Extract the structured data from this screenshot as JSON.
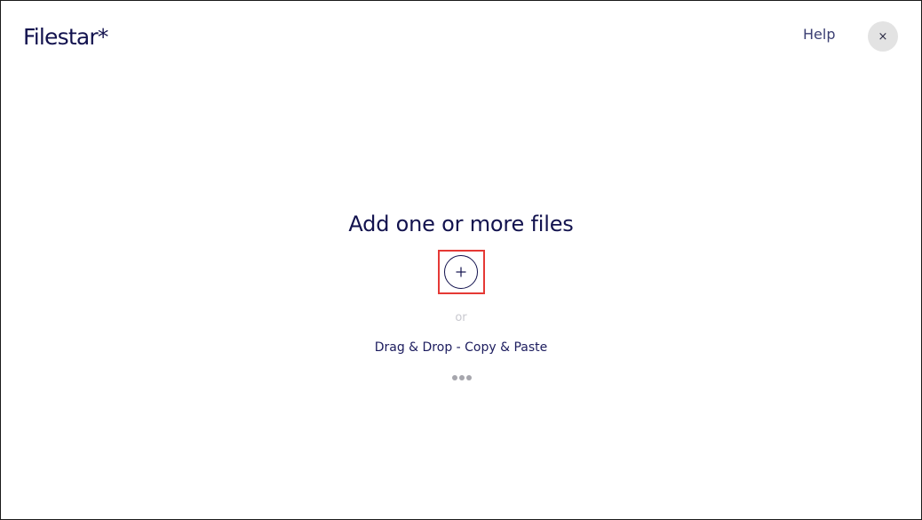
{
  "header": {
    "logo_text": "Filestar*",
    "help_label": "Help",
    "close_label": "×"
  },
  "main": {
    "headline": "Add one or more files",
    "or_label": "or",
    "drag_drop_label": "Drag & Drop - Copy & Paste"
  },
  "icons": {
    "add": "plus-icon",
    "close": "close-icon",
    "more": "more-dots-icon"
  },
  "colors": {
    "brand_navy": "#12124e",
    "close_bg": "#e3e3e3",
    "highlight": "#e53935",
    "muted": "#c8c8cf",
    "dots": "#a6a6ad"
  }
}
